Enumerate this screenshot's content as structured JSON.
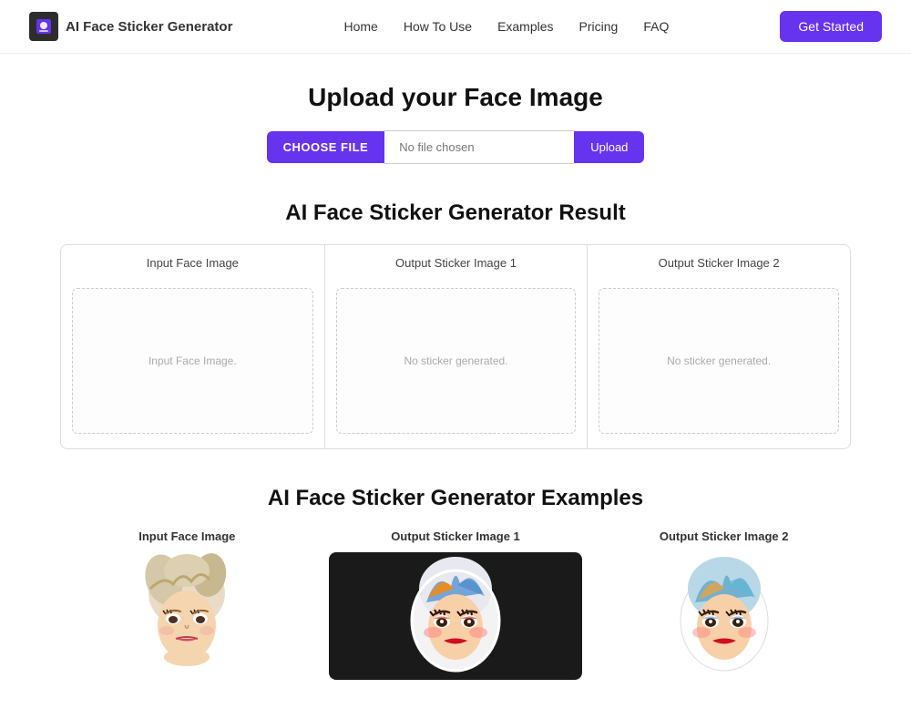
{
  "header": {
    "logo_text": "AI Face Sticker Generator",
    "nav_items": [
      {
        "label": "Home",
        "href": "#"
      },
      {
        "label": "How To Use",
        "href": "#"
      },
      {
        "label": "Examples",
        "href": "#"
      },
      {
        "label": "Pricing",
        "href": "#"
      },
      {
        "label": "FAQ",
        "href": "#"
      }
    ],
    "cta_button": "Get Started"
  },
  "upload_section": {
    "title": "Upload your Face Image",
    "choose_file_btn": "CHOOSE FILE",
    "file_placeholder": "No file chosen",
    "upload_btn": "Upload"
  },
  "result_section": {
    "title": "AI Face Sticker Generator Result",
    "columns": [
      {
        "header": "Input Face Image",
        "placeholder": "Input Face Image."
      },
      {
        "header": "Output Sticker Image 1",
        "placeholder": "No sticker generated."
      },
      {
        "header": "Output Sticker Image 2",
        "placeholder": "No sticker generated."
      }
    ]
  },
  "examples_section": {
    "title": "AI Face Sticker Generator Examples",
    "columns": [
      {
        "header": "Input Face Image",
        "bg": "white"
      },
      {
        "header": "Output Sticker Image 1",
        "bg": "dark"
      },
      {
        "header": "Output Sticker Image 2",
        "bg": "white"
      }
    ]
  },
  "colors": {
    "accent": "#6633ee",
    "text_primary": "#111111",
    "text_secondary": "#666666"
  }
}
